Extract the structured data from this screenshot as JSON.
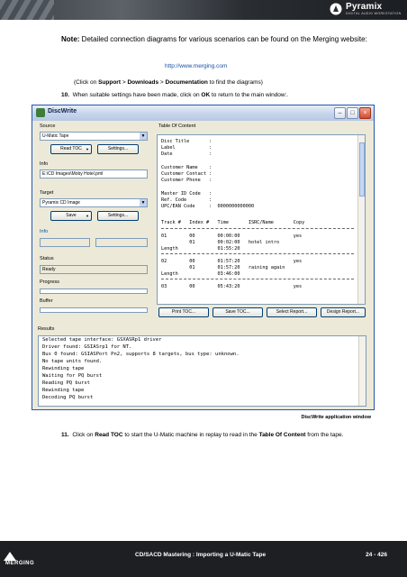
{
  "header": {
    "brand": "Pyramix",
    "tagline": "DIGITAL AUDIO WORKSTATION"
  },
  "note": {
    "prefix": "Note:",
    "text": " Detailed connection diagrams for various scenarios can be found on the Merging website:",
    "url": "http://www.merging.com"
  },
  "instruction_1": {
    "open": "(Click on ",
    "support": "Support",
    "sep1": " > ",
    "downloads": "Downloads",
    "sep2": " > ",
    "documentation": "Documentation",
    "close": " to find the diagrams)"
  },
  "step_10": {
    "number": "10.",
    "pre": "When suitable settings have been made, click on ",
    "ok": "OK",
    "post": " to return to the main window:."
  },
  "dialog": {
    "title": "DiscWrite",
    "source_label": "Source",
    "source_value": "U-Matic Tape",
    "read_toc_button": "Read TOC",
    "settings_button_1": "Settings...",
    "info_label": "Info",
    "info_path": "E:\\CD Images\\Moby Hotel.pml",
    "target_label": "Target",
    "target_value": "Pyramix CD Image",
    "save_button": "Save",
    "settings_button_2": "Settings...",
    "info2_label": "Info",
    "status_label": "Status",
    "status_value": "Ready",
    "progress_label": "Progress",
    "buffer_label": "Buffer",
    "toc_label": "Table Of Content",
    "toc": {
      "disc_title": "Disc Title       :",
      "label": "Label            :",
      "date": "Date             :",
      "customer_name": "Customer Name    :",
      "customer_contact": "Customer Contact :",
      "customer_phone": "Customer Phone   :",
      "master_id": "Master ID Code   :",
      "ref_code": "Ref. Code        :",
      "upc_ean": "UPC/EAN Code     :  0000000000000",
      "columns": "Track #   Index #   Time       ISRC/Name       Copy",
      "row1": "01        00        00:00:00                   yes",
      "row1b": "          01        00:02:00   hotel intro",
      "row1c": "Length              01:55:20",
      "row2": "02        00        01:57:20                   yes",
      "row2b": "          01        01:57:20   raining again",
      "row2c": "Length              03:46:00",
      "row3": "03        00        05:43:20                   yes"
    },
    "print_toc_button": "Print TOC...",
    "save_toc_button": "Save TOC...",
    "select_report_button": "Select Report...",
    "design_report_button": "Design Report...",
    "results_label": "Results",
    "results": [
      "Selected tape interface: GSXASRp1 driver",
      "Driver found: GSIASrp1 for NT.",
      "Bus 0 found: GSIASPort Pn2, supports 8 targets, bus type: unknown.",
      "No tape units found.",
      "Rewinding tape",
      "Waiting for PQ burst",
      "Reading PQ burst",
      "Rewinding tape",
      "Decoding PQ burst"
    ]
  },
  "caption": "DiscWrite application window",
  "step_11": {
    "number": "11.",
    "pre": "Click on ",
    "read_toc": "Read TOC",
    "mid": " to start the U-Matic machine in replay to read in the ",
    "toc": "Table Of Content",
    "post": " from the tape."
  },
  "footer": {
    "logo": "MERGING",
    "title": "CD/SACD Mastering : Importing a U-Matic Tape",
    "page": "24 - 426"
  }
}
